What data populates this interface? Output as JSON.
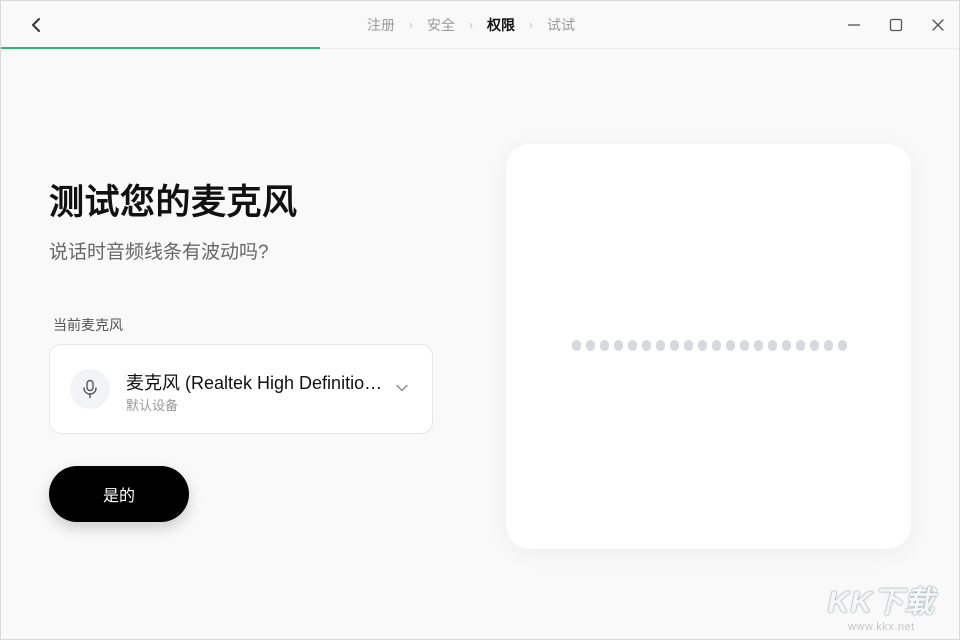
{
  "nav": {
    "steps": [
      {
        "label": "注册",
        "active": false
      },
      {
        "label": "安全",
        "active": false
      },
      {
        "label": "权限",
        "active": true
      },
      {
        "label": "试试",
        "active": false
      }
    ],
    "separator": "›",
    "progress_fraction": 0.333
  },
  "main": {
    "title": "测试您的麦克风",
    "subtitle": "说话时音频线条有波动吗?",
    "mic_label": "当前麦克风",
    "mic_device": {
      "name": "麦克风 (Realtek High Definition Audio)",
      "sub": "默认设备"
    },
    "confirm_label": "是的"
  },
  "waveform": {
    "bar_count": 20,
    "levels": [
      0,
      0,
      0,
      0,
      0,
      0,
      0,
      0,
      0,
      0,
      0,
      0,
      0,
      0,
      0,
      0,
      0,
      0,
      0,
      0
    ],
    "color": "#d7d9de"
  },
  "accent_color": "#2bb673",
  "watermark": {
    "logo": "KK下载",
    "url": "www.kkx.net"
  }
}
